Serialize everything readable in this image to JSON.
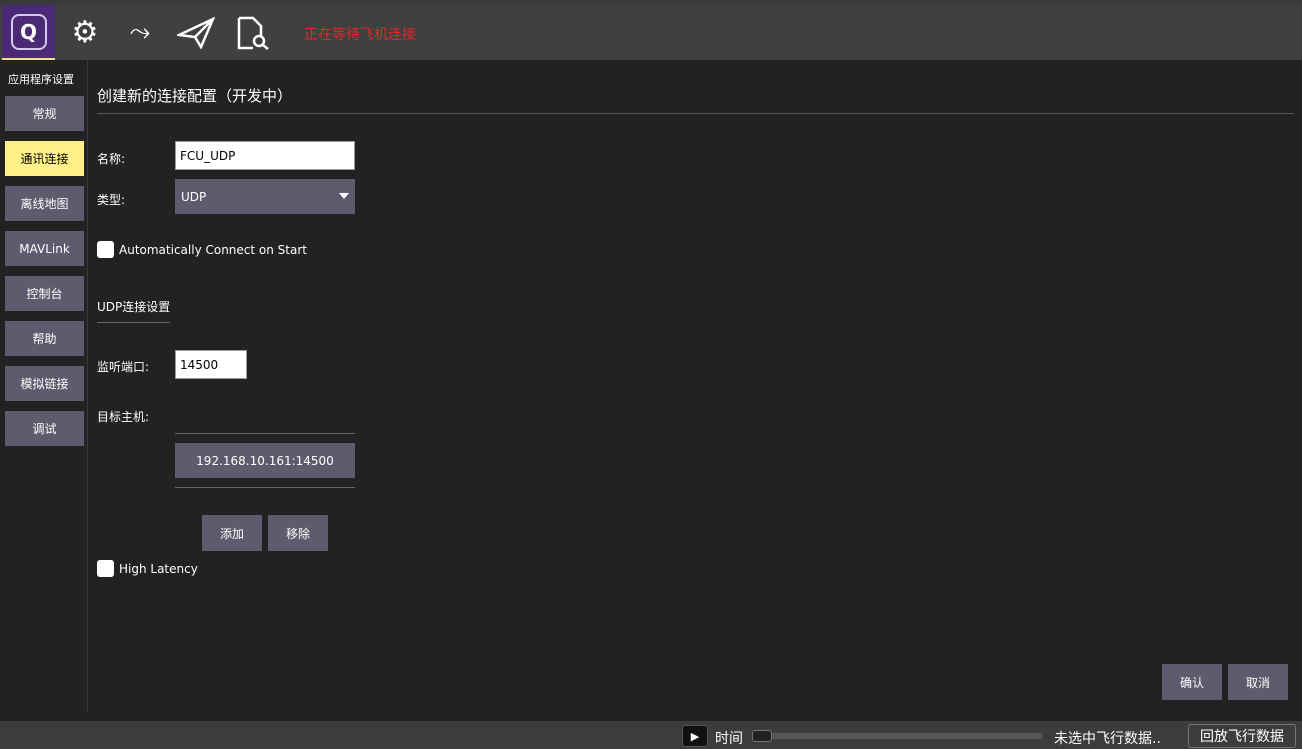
{
  "toolbar": {
    "status": "正在等待飞机连接",
    "icons": [
      "qgc-logo-icon",
      "settings-gears-icon",
      "plan-route-icon",
      "fly-paper-plane-icon",
      "analyze-document-icon"
    ]
  },
  "sidebar": {
    "title": "应用程序设置",
    "items": [
      {
        "label": "常规"
      },
      {
        "label": "通讯连接",
        "active": true
      },
      {
        "label": "离线地图"
      },
      {
        "label": "MAVLink"
      },
      {
        "label": "控制台"
      },
      {
        "label": "帮助"
      },
      {
        "label": "模拟链接"
      },
      {
        "label": "调试"
      }
    ]
  },
  "main": {
    "heading": "创建新的连接配置（开发中）",
    "name_label": "名称:",
    "name_value": "FCU_UDP",
    "type_label": "类型:",
    "type_value": "UDP",
    "auto_connect": {
      "label": "Automatically Connect on Start",
      "checked": false
    },
    "udp_section": "UDP连接设置",
    "port_label": "监听端口:",
    "port_value": "14500",
    "target_label": "目标主机:",
    "target_host": "192.168.10.161:14500",
    "add": "添加",
    "remove": "移除",
    "high_latency": {
      "label": "High Latency",
      "checked": false
    },
    "ok": "确认",
    "cancel": "取消"
  },
  "bottom": {
    "play": "▶",
    "time": "时间",
    "no_selection": "未选中飞行数据..",
    "replay": "回放飞行数据"
  }
}
